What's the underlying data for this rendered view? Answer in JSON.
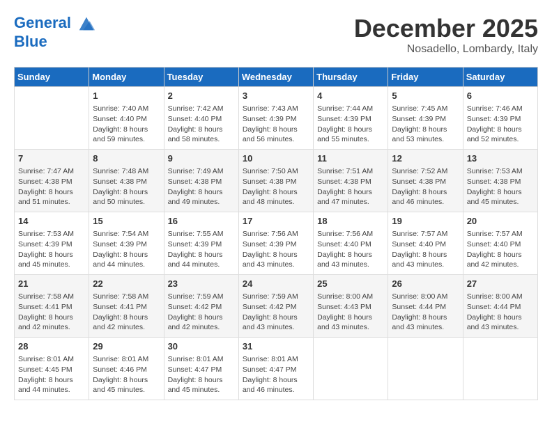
{
  "header": {
    "logo_line1": "General",
    "logo_line2": "Blue",
    "month": "December 2025",
    "location": "Nosadello, Lombardy, Italy"
  },
  "days_of_week": [
    "Sunday",
    "Monday",
    "Tuesday",
    "Wednesday",
    "Thursday",
    "Friday",
    "Saturday"
  ],
  "weeks": [
    [
      {
        "day": "",
        "info": ""
      },
      {
        "day": "1",
        "info": "Sunrise: 7:40 AM\nSunset: 4:40 PM\nDaylight: 8 hours\nand 59 minutes."
      },
      {
        "day": "2",
        "info": "Sunrise: 7:42 AM\nSunset: 4:40 PM\nDaylight: 8 hours\nand 58 minutes."
      },
      {
        "day": "3",
        "info": "Sunrise: 7:43 AM\nSunset: 4:39 PM\nDaylight: 8 hours\nand 56 minutes."
      },
      {
        "day": "4",
        "info": "Sunrise: 7:44 AM\nSunset: 4:39 PM\nDaylight: 8 hours\nand 55 minutes."
      },
      {
        "day": "5",
        "info": "Sunrise: 7:45 AM\nSunset: 4:39 PM\nDaylight: 8 hours\nand 53 minutes."
      },
      {
        "day": "6",
        "info": "Sunrise: 7:46 AM\nSunset: 4:39 PM\nDaylight: 8 hours\nand 52 minutes."
      }
    ],
    [
      {
        "day": "7",
        "info": "Sunrise: 7:47 AM\nSunset: 4:38 PM\nDaylight: 8 hours\nand 51 minutes."
      },
      {
        "day": "8",
        "info": "Sunrise: 7:48 AM\nSunset: 4:38 PM\nDaylight: 8 hours\nand 50 minutes."
      },
      {
        "day": "9",
        "info": "Sunrise: 7:49 AM\nSunset: 4:38 PM\nDaylight: 8 hours\nand 49 minutes."
      },
      {
        "day": "10",
        "info": "Sunrise: 7:50 AM\nSunset: 4:38 PM\nDaylight: 8 hours\nand 48 minutes."
      },
      {
        "day": "11",
        "info": "Sunrise: 7:51 AM\nSunset: 4:38 PM\nDaylight: 8 hours\nand 47 minutes."
      },
      {
        "day": "12",
        "info": "Sunrise: 7:52 AM\nSunset: 4:38 PM\nDaylight: 8 hours\nand 46 minutes."
      },
      {
        "day": "13",
        "info": "Sunrise: 7:53 AM\nSunset: 4:38 PM\nDaylight: 8 hours\nand 45 minutes."
      }
    ],
    [
      {
        "day": "14",
        "info": "Sunrise: 7:53 AM\nSunset: 4:39 PM\nDaylight: 8 hours\nand 45 minutes."
      },
      {
        "day": "15",
        "info": "Sunrise: 7:54 AM\nSunset: 4:39 PM\nDaylight: 8 hours\nand 44 minutes."
      },
      {
        "day": "16",
        "info": "Sunrise: 7:55 AM\nSunset: 4:39 PM\nDaylight: 8 hours\nand 44 minutes."
      },
      {
        "day": "17",
        "info": "Sunrise: 7:56 AM\nSunset: 4:39 PM\nDaylight: 8 hours\nand 43 minutes."
      },
      {
        "day": "18",
        "info": "Sunrise: 7:56 AM\nSunset: 4:40 PM\nDaylight: 8 hours\nand 43 minutes."
      },
      {
        "day": "19",
        "info": "Sunrise: 7:57 AM\nSunset: 4:40 PM\nDaylight: 8 hours\nand 43 minutes."
      },
      {
        "day": "20",
        "info": "Sunrise: 7:57 AM\nSunset: 4:40 PM\nDaylight: 8 hours\nand 42 minutes."
      }
    ],
    [
      {
        "day": "21",
        "info": "Sunrise: 7:58 AM\nSunset: 4:41 PM\nDaylight: 8 hours\nand 42 minutes."
      },
      {
        "day": "22",
        "info": "Sunrise: 7:58 AM\nSunset: 4:41 PM\nDaylight: 8 hours\nand 42 minutes."
      },
      {
        "day": "23",
        "info": "Sunrise: 7:59 AM\nSunset: 4:42 PM\nDaylight: 8 hours\nand 42 minutes."
      },
      {
        "day": "24",
        "info": "Sunrise: 7:59 AM\nSunset: 4:42 PM\nDaylight: 8 hours\nand 43 minutes."
      },
      {
        "day": "25",
        "info": "Sunrise: 8:00 AM\nSunset: 4:43 PM\nDaylight: 8 hours\nand 43 minutes."
      },
      {
        "day": "26",
        "info": "Sunrise: 8:00 AM\nSunset: 4:44 PM\nDaylight: 8 hours\nand 43 minutes."
      },
      {
        "day": "27",
        "info": "Sunrise: 8:00 AM\nSunset: 4:44 PM\nDaylight: 8 hours\nand 43 minutes."
      }
    ],
    [
      {
        "day": "28",
        "info": "Sunrise: 8:01 AM\nSunset: 4:45 PM\nDaylight: 8 hours\nand 44 minutes."
      },
      {
        "day": "29",
        "info": "Sunrise: 8:01 AM\nSunset: 4:46 PM\nDaylight: 8 hours\nand 45 minutes."
      },
      {
        "day": "30",
        "info": "Sunrise: 8:01 AM\nSunset: 4:47 PM\nDaylight: 8 hours\nand 45 minutes."
      },
      {
        "day": "31",
        "info": "Sunrise: 8:01 AM\nSunset: 4:47 PM\nDaylight: 8 hours\nand 46 minutes."
      },
      {
        "day": "",
        "info": ""
      },
      {
        "day": "",
        "info": ""
      },
      {
        "day": "",
        "info": ""
      }
    ]
  ]
}
